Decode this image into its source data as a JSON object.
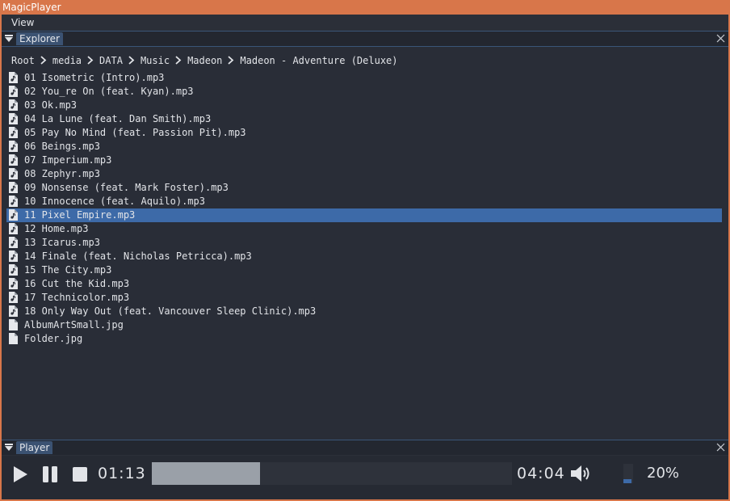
{
  "window": {
    "title": "MagicPlayer"
  },
  "menubar": {
    "items": [
      "View"
    ]
  },
  "explorer": {
    "tab_label": "Explorer",
    "breadcrumb": [
      "Root",
      "media",
      "DATA",
      "Music",
      "Madeon",
      "Madeon - Adventure (Deluxe)"
    ],
    "files": [
      {
        "name": "01 Isometric (Intro).mp3",
        "type": "audio"
      },
      {
        "name": "02 You_re On (feat. Kyan).mp3",
        "type": "audio"
      },
      {
        "name": "03 Ok.mp3",
        "type": "audio"
      },
      {
        "name": "04 La Lune (feat. Dan Smith).mp3",
        "type": "audio"
      },
      {
        "name": "05 Pay No Mind (feat. Passion Pit).mp3",
        "type": "audio"
      },
      {
        "name": "06 Beings.mp3",
        "type": "audio"
      },
      {
        "name": "07 Imperium.mp3",
        "type": "audio"
      },
      {
        "name": "08 Zephyr.mp3",
        "type": "audio"
      },
      {
        "name": "09 Nonsense (feat. Mark Foster).mp3",
        "type": "audio"
      },
      {
        "name": "10 Innocence (feat. Aquilo).mp3",
        "type": "audio"
      },
      {
        "name": "11 Pixel Empire.mp3",
        "type": "audio",
        "selected": true
      },
      {
        "name": "12 Home.mp3",
        "type": "audio"
      },
      {
        "name": "13 Icarus.mp3",
        "type": "audio"
      },
      {
        "name": "14 Finale (feat. Nicholas Petricca).mp3",
        "type": "audio"
      },
      {
        "name": "15 The City.mp3",
        "type": "audio"
      },
      {
        "name": "16 Cut the Kid.mp3",
        "type": "audio"
      },
      {
        "name": "17 Technicolor.mp3",
        "type": "audio"
      },
      {
        "name": "18 Only Way Out (feat. Vancouver Sleep Clinic).mp3",
        "type": "audio"
      },
      {
        "name": "AlbumArtSmall.jpg",
        "type": "file"
      },
      {
        "name": "Folder.jpg",
        "type": "file"
      }
    ]
  },
  "player": {
    "tab_label": "Player",
    "elapsed": "01:13",
    "duration": "04:04",
    "progress_fraction": 0.3,
    "volume_fraction": 0.2,
    "volume_label": "20%"
  },
  "icons": {
    "panel_collapse": "triangle-down-icon",
    "panel_close": "close-icon",
    "breadcrumb_sep": "chevron-right-icon",
    "audio_file": "audio-file-icon",
    "generic_file": "file-icon",
    "play": "play-icon",
    "pause": "pause-icon",
    "stop": "stop-icon",
    "volume": "speaker-icon"
  },
  "colors": {
    "title_bar": "#d8764a",
    "background": "#2b2f38",
    "selection": "#3d6aa8",
    "tab": "#3b5272",
    "progress_fill": "#9aa0a8"
  }
}
